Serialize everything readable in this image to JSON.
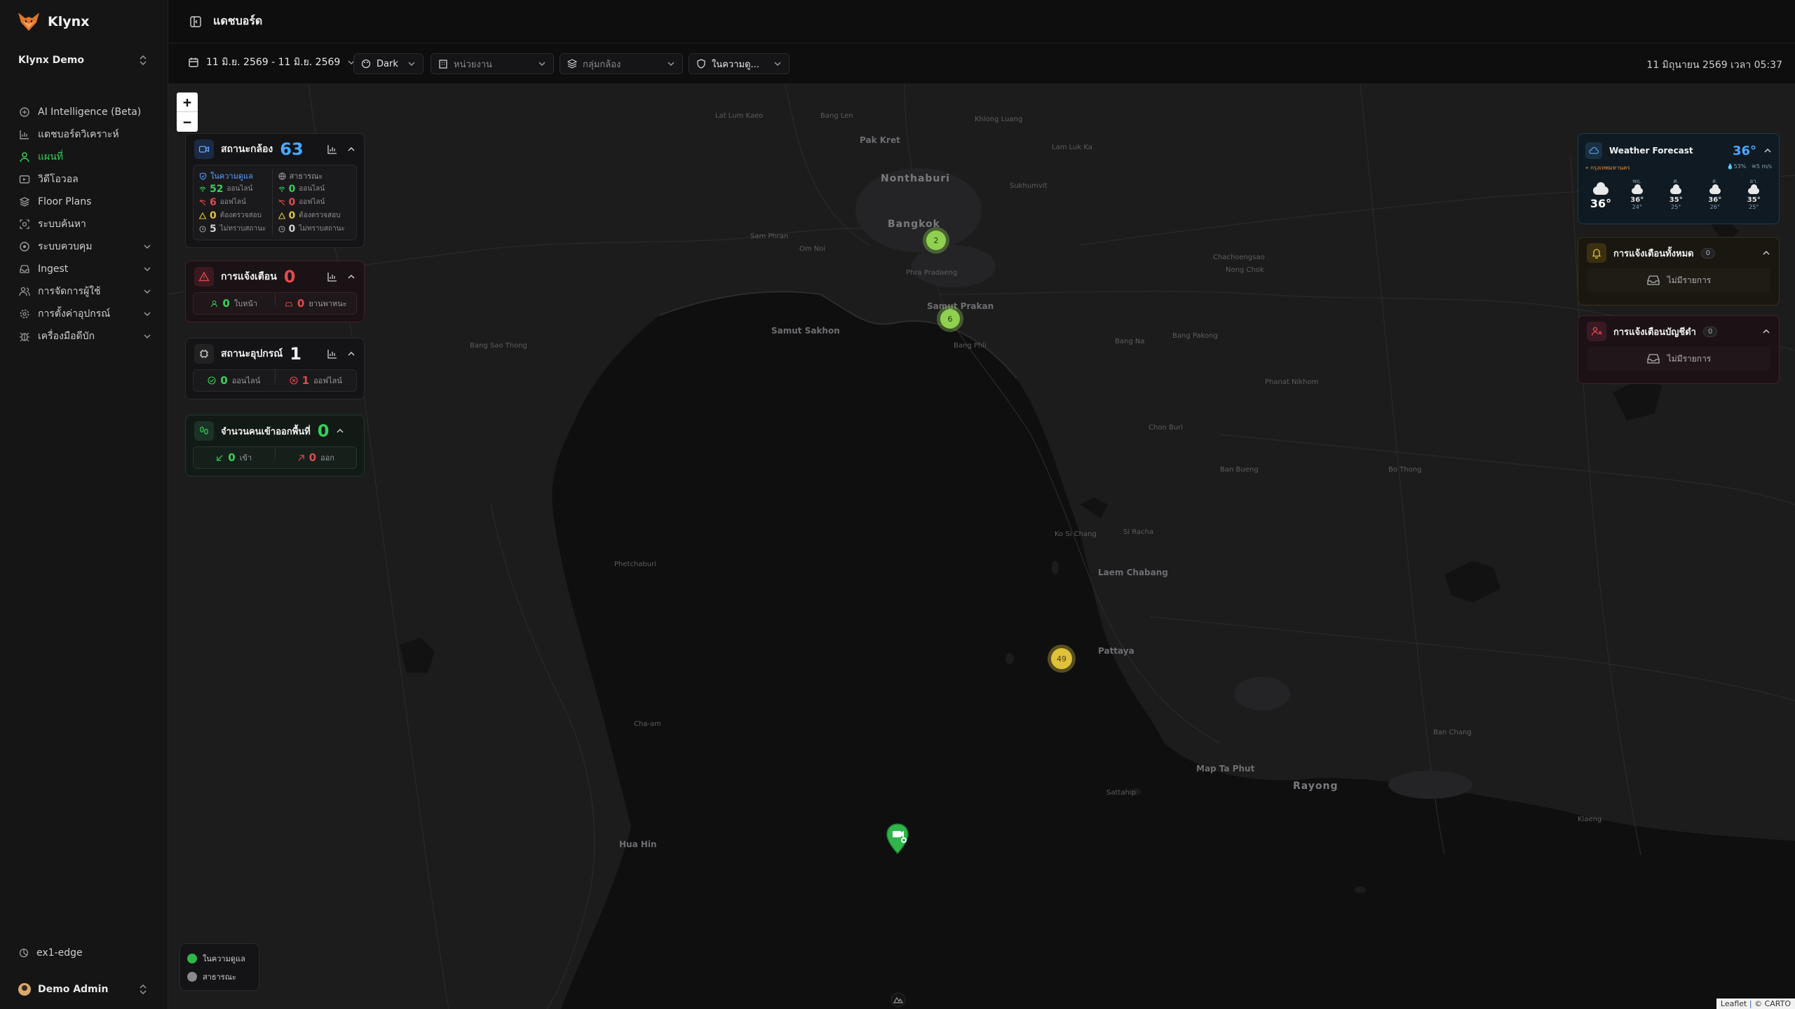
{
  "app": {
    "name": "Klynx",
    "org": "Klynx Demo"
  },
  "sidebar": {
    "items": [
      {
        "label": "AI Intelligence (Beta)",
        "icon": "brain-icon",
        "chevron": false,
        "active": false
      },
      {
        "label": "แดชบอร์ดวิเคราะห์",
        "icon": "analytics-icon",
        "chevron": false,
        "active": false
      },
      {
        "label": "แผนที่",
        "icon": "map-pin-icon",
        "chevron": false,
        "active": true
      },
      {
        "label": "วิดีโอวอล",
        "icon": "video-wall-icon",
        "chevron": false,
        "active": false
      },
      {
        "label": "Floor Plans",
        "icon": "layers-icon",
        "chevron": false,
        "active": false
      },
      {
        "label": "ระบบค้นหา",
        "icon": "scan-search-icon",
        "chevron": false,
        "active": false
      },
      {
        "label": "ระบบควบคุม",
        "icon": "control-icon",
        "chevron": true,
        "active": false
      },
      {
        "label": "Ingest",
        "icon": "inbox-icon",
        "chevron": true,
        "active": false
      },
      {
        "label": "การจัดการผู้ใช้",
        "icon": "users-icon",
        "chevron": true,
        "active": false
      },
      {
        "label": "การตั้งค่าอุปกรณ์",
        "icon": "gear-icon",
        "chevron": true,
        "active": false
      },
      {
        "label": "เครื่องมือดีบัก",
        "icon": "bug-icon",
        "chevron": true,
        "active": false
      }
    ],
    "edge_label": "ex1-edge",
    "user_name": "Demo Admin"
  },
  "header": {
    "title": "แดชบอร์ด"
  },
  "filters": {
    "date_range": "11 มิ.ย. 2569 - 11 มิ.ย. 2569",
    "theme": "Dark",
    "unit_placeholder": "หน่วยงาน",
    "camera_group_placeholder": "กลุ่มกล้อง",
    "scope": "ในความดู...",
    "datetime": "11 มิถุนายน 2569 เวลา 05:37"
  },
  "map": {
    "zoom_in": "+",
    "zoom_out": "−",
    "clusters": [
      {
        "count": "2",
        "color": "#8fd14f"
      },
      {
        "count": "6",
        "color": "#8fd14f"
      },
      {
        "count": "49",
        "color": "#e0c23a"
      }
    ],
    "labels": [
      "Pak Kret",
      "Nonthaburi",
      "Bangkok",
      "Samut Prakan",
      "Samut Sakhon",
      "Hua Hin",
      "Pattaya",
      "Laem Chabang",
      "Rayong",
      "Map Ta Phut",
      "Sattahip",
      "Chon Buri",
      "Bang Phli",
      "Bang Na",
      "Si Racha",
      "Ko Si Chang",
      "Cha-am",
      "Phetchaburi",
      "Bang Sao Thong",
      "Phra Pradaeng",
      "Om Noi",
      "Sam Phran",
      "Bang Len",
      "Lat Lum Kaeo",
      "Khlong Luang",
      "Lam Luk Ka",
      "Nong Chok",
      "Chachoengsao",
      "Bang Pakong",
      "Phanat Nikhom",
      "Ban Bueng",
      "Bo Thong",
      "Klaeng",
      "Ban Chang",
      "Sukhumvit"
    ],
    "attribution": {
      "leaflet": "Leaflet",
      "carto": "© CARTO"
    }
  },
  "widgets": {
    "camera_status": {
      "title": "สถานะกล้อง",
      "count": "63",
      "col1_title": "ในความดูแล",
      "col2_title": "สาธารณะ",
      "online_label": "ออนไลน์",
      "offline_label": "ออฟไลน์",
      "warn_label": "ต้องตรวจสอบ",
      "unknown_label": "ไม่ทราบสถานะ",
      "col1": {
        "online": "52",
        "offline": "6",
        "warn": "0",
        "unknown": "5"
      },
      "col2": {
        "online": "0",
        "offline": "0",
        "warn": "0",
        "unknown": "0"
      }
    },
    "alerts": {
      "title": "การแจ้งเตือน",
      "count": "0",
      "faces": "0",
      "faces_label": "ใบหน้า",
      "vehicles": "0",
      "vehicles_label": "ยานพาหนะ"
    },
    "device_status": {
      "title": "สถานะอุปกรณ์",
      "count": "1",
      "online": "0",
      "online_label": "ออนไลน์",
      "offline": "1",
      "offline_label": "ออฟไลน์"
    },
    "people_count": {
      "title": "จำนวนคนเข้าออกพื้นที่",
      "count": "0",
      "in": "0",
      "in_label": "เข้า",
      "out": "0",
      "out_label": "ออก"
    }
  },
  "weather": {
    "title": "Weather Forecast",
    "temp": "36°",
    "location": "กรุงเทพมหานคร",
    "humidity": "53%",
    "wind": "5 m/s",
    "now": "36°",
    "days": [
      {
        "d": "พฤ.",
        "hi": "36°",
        "lo": "24°"
      },
      {
        "d": "ศ.",
        "hi": "35°",
        "lo": "25°"
      },
      {
        "d": "ส.",
        "hi": "36°",
        "lo": "26°"
      },
      {
        "d": "อา.",
        "hi": "35°",
        "lo": "25°"
      }
    ]
  },
  "right_alerts": {
    "all": {
      "title": "การแจ้งเตือนทั้งหมด",
      "count": "0",
      "empty": "ไม่มีรายการ"
    },
    "blacklist": {
      "title": "การแจ้งเตือนบัญชีดำ",
      "count": "0",
      "empty": "ไม่มีรายการ"
    }
  },
  "legend": {
    "owned": "ในความดูแล",
    "public": "สาธารณะ"
  },
  "colors": {
    "accent_green": "#34d058",
    "accent_blue": "#4aa8ff",
    "alert_red": "#e5484d",
    "warn_yellow": "#e0c23a"
  }
}
